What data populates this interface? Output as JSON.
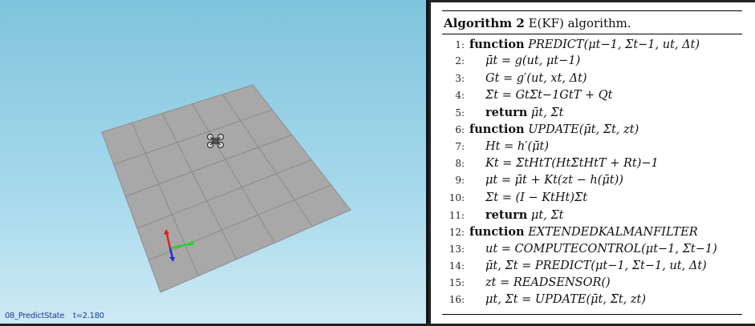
{
  "status_bar": {
    "scenario": "08_PredictState",
    "time": "t=2.180"
  },
  "algorithm": {
    "header_bold": "Algorithm 2",
    "header_title": "E(KF) algorithm.",
    "lines": [
      {
        "num": "1:",
        "indent": 0,
        "kw": "function",
        "text": "PREDICT(μt−1, Σt−1, ut, Δt)"
      },
      {
        "num": "2:",
        "indent": 1,
        "kw": "",
        "text": "μ̄t = g(ut, μt−1)"
      },
      {
        "num": "3:",
        "indent": 1,
        "kw": "",
        "text": "Gt = g′(ut, xt, Δt)"
      },
      {
        "num": "4:",
        "indent": 1,
        "kw": "",
        "text": "Σ̄t = GtΣt−1GtT + Qt"
      },
      {
        "num": "5:",
        "indent": 1,
        "kw": "return",
        "text": "μ̄t, Σ̄t"
      },
      {
        "num": "6:",
        "indent": 0,
        "kw": "function",
        "text": "UPDATE(μ̄t, Σ̄t, zt)"
      },
      {
        "num": "7:",
        "indent": 1,
        "kw": "",
        "text": "Ht = h′(μ̄t)"
      },
      {
        "num": "8:",
        "indent": 1,
        "kw": "",
        "text": "Kt = Σ̄tHtT(HtΣ̄tHtT + Rt)−1"
      },
      {
        "num": "9:",
        "indent": 1,
        "kw": "",
        "text": "μt = μ̄t + Kt(zt − h(μ̄t))"
      },
      {
        "num": "10:",
        "indent": 1,
        "kw": "",
        "text": "Σt = (I − KtHt)Σ̄t"
      },
      {
        "num": "11:",
        "indent": 1,
        "kw": "return",
        "text": "μt, Σt"
      },
      {
        "num": "12:",
        "indent": 0,
        "kw": "function",
        "text": "EXTENDEDKALMANFILTER"
      },
      {
        "num": "13:",
        "indent": 1,
        "kw": "",
        "text": "ut = COMPUTECONTROL(μt−1, Σt−1)"
      },
      {
        "num": "14:",
        "indent": 1,
        "kw": "",
        "text": "μ̄t, Σ̄t = PREDICT(μt−1, Σt−1, ut, Δt)"
      },
      {
        "num": "15:",
        "indent": 1,
        "kw": "",
        "text": "zt = READSENSOR()"
      },
      {
        "num": "16:",
        "indent": 1,
        "kw": "",
        "text": "μt, Σt = UPDATE(μ̄t, Σ̄t, zt)"
      }
    ]
  },
  "colors": {
    "sky_top": "#7fc4dd",
    "floor": "#a6a6a6",
    "axis_x": "#2ecc2e",
    "axis_y": "#e02020",
    "axis_z": "#2a2ad8",
    "status_text": "#1a3ca0"
  }
}
